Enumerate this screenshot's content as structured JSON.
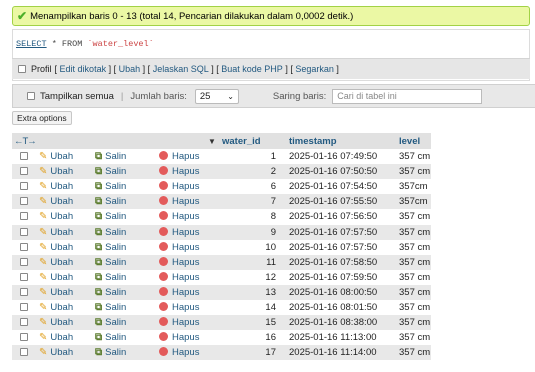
{
  "status": {
    "message": "Menampilkan baris 0 - 13 (total 14, Pencarian dilakukan dalam 0,0002 detik.)"
  },
  "sql": {
    "select_kw": "SELECT",
    "rest": " * FROM ",
    "table": "`water_level`"
  },
  "profiling": {
    "profil": "Profil",
    "links": [
      "Edit dikotak",
      "Ubah",
      "Jelaskan SQL",
      "Buat kode PHP",
      "Segarkan"
    ]
  },
  "nav": {
    "show_all": "Tampilkan semua",
    "rows_label": "Jumlah baris:",
    "rows_value": "25",
    "filter_label": "Saring baris:",
    "filter_placeholder": "Cari di tabel ini"
  },
  "extra_options": "Extra options",
  "table": {
    "columns": {
      "water_id": "water_id",
      "timestamp": "timestamp",
      "level": "level"
    },
    "actions": {
      "edit": "Ubah",
      "copy": "Salin",
      "delete": "Hapus"
    },
    "rows": [
      {
        "id": "1",
        "timestamp": "2025-01-16 07:49:50",
        "level": "357 cm"
      },
      {
        "id": "2",
        "timestamp": "2025-01-16 07:50:50",
        "level": "357 cm"
      },
      {
        "id": "6",
        "timestamp": "2025-01-16 07:54:50",
        "level": "357cm"
      },
      {
        "id": "7",
        "timestamp": "2025-01-16 07:55:50",
        "level": "357cm"
      },
      {
        "id": "8",
        "timestamp": "2025-01-16 07:56:50",
        "level": "357 cm"
      },
      {
        "id": "9",
        "timestamp": "2025-01-16 07:57:50",
        "level": "357 cm"
      },
      {
        "id": "10",
        "timestamp": "2025-01-16 07:57:50",
        "level": "357 cm"
      },
      {
        "id": "11",
        "timestamp": "2025-01-16 07:58:50",
        "level": "357 cm"
      },
      {
        "id": "12",
        "timestamp": "2025-01-16 07:59:50",
        "level": "357 cm"
      },
      {
        "id": "13",
        "timestamp": "2025-01-16 08:00:50",
        "level": "357 cm"
      },
      {
        "id": "14",
        "timestamp": "2025-01-16 08:01:50",
        "level": "357 cm"
      },
      {
        "id": "15",
        "timestamp": "2025-01-16 08:38:00",
        "level": "357 cm"
      },
      {
        "id": "16",
        "timestamp": "2025-01-16 11:13:00",
        "level": "357 cm"
      },
      {
        "id": "17",
        "timestamp": "2025-01-16 11:14:00",
        "level": "357 cm"
      }
    ]
  },
  "icons": {
    "success": "check-icon",
    "edit": "pencil-icon",
    "copy": "copy-icon",
    "delete": "delete-icon"
  },
  "colors": {
    "success_bg": "#ebf8a4",
    "link": "#235a81",
    "row_alt": "#e8e8e8",
    "delete": "#e35b5b"
  }
}
